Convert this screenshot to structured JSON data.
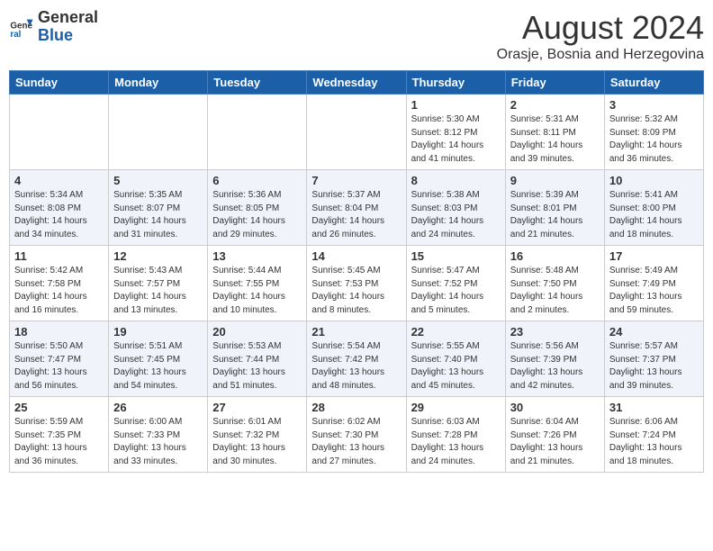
{
  "header": {
    "logo_general": "General",
    "logo_blue": "Blue",
    "month_title": "August 2024",
    "location": "Orasje, Bosnia and Herzegovina"
  },
  "weekdays": [
    "Sunday",
    "Monday",
    "Tuesday",
    "Wednesday",
    "Thursday",
    "Friday",
    "Saturday"
  ],
  "weeks": [
    [
      {
        "day": "",
        "info": ""
      },
      {
        "day": "",
        "info": ""
      },
      {
        "day": "",
        "info": ""
      },
      {
        "day": "",
        "info": ""
      },
      {
        "day": "1",
        "info": "Sunrise: 5:30 AM\nSunset: 8:12 PM\nDaylight: 14 hours\nand 41 minutes."
      },
      {
        "day": "2",
        "info": "Sunrise: 5:31 AM\nSunset: 8:11 PM\nDaylight: 14 hours\nand 39 minutes."
      },
      {
        "day": "3",
        "info": "Sunrise: 5:32 AM\nSunset: 8:09 PM\nDaylight: 14 hours\nand 36 minutes."
      }
    ],
    [
      {
        "day": "4",
        "info": "Sunrise: 5:34 AM\nSunset: 8:08 PM\nDaylight: 14 hours\nand 34 minutes."
      },
      {
        "day": "5",
        "info": "Sunrise: 5:35 AM\nSunset: 8:07 PM\nDaylight: 14 hours\nand 31 minutes."
      },
      {
        "day": "6",
        "info": "Sunrise: 5:36 AM\nSunset: 8:05 PM\nDaylight: 14 hours\nand 29 minutes."
      },
      {
        "day": "7",
        "info": "Sunrise: 5:37 AM\nSunset: 8:04 PM\nDaylight: 14 hours\nand 26 minutes."
      },
      {
        "day": "8",
        "info": "Sunrise: 5:38 AM\nSunset: 8:03 PM\nDaylight: 14 hours\nand 24 minutes."
      },
      {
        "day": "9",
        "info": "Sunrise: 5:39 AM\nSunset: 8:01 PM\nDaylight: 14 hours\nand 21 minutes."
      },
      {
        "day": "10",
        "info": "Sunrise: 5:41 AM\nSunset: 8:00 PM\nDaylight: 14 hours\nand 18 minutes."
      }
    ],
    [
      {
        "day": "11",
        "info": "Sunrise: 5:42 AM\nSunset: 7:58 PM\nDaylight: 14 hours\nand 16 minutes."
      },
      {
        "day": "12",
        "info": "Sunrise: 5:43 AM\nSunset: 7:57 PM\nDaylight: 14 hours\nand 13 minutes."
      },
      {
        "day": "13",
        "info": "Sunrise: 5:44 AM\nSunset: 7:55 PM\nDaylight: 14 hours\nand 10 minutes."
      },
      {
        "day": "14",
        "info": "Sunrise: 5:45 AM\nSunset: 7:53 PM\nDaylight: 14 hours\nand 8 minutes."
      },
      {
        "day": "15",
        "info": "Sunrise: 5:47 AM\nSunset: 7:52 PM\nDaylight: 14 hours\nand 5 minutes."
      },
      {
        "day": "16",
        "info": "Sunrise: 5:48 AM\nSunset: 7:50 PM\nDaylight: 14 hours\nand 2 minutes."
      },
      {
        "day": "17",
        "info": "Sunrise: 5:49 AM\nSunset: 7:49 PM\nDaylight: 13 hours\nand 59 minutes."
      }
    ],
    [
      {
        "day": "18",
        "info": "Sunrise: 5:50 AM\nSunset: 7:47 PM\nDaylight: 13 hours\nand 56 minutes."
      },
      {
        "day": "19",
        "info": "Sunrise: 5:51 AM\nSunset: 7:45 PM\nDaylight: 13 hours\nand 54 minutes."
      },
      {
        "day": "20",
        "info": "Sunrise: 5:53 AM\nSunset: 7:44 PM\nDaylight: 13 hours\nand 51 minutes."
      },
      {
        "day": "21",
        "info": "Sunrise: 5:54 AM\nSunset: 7:42 PM\nDaylight: 13 hours\nand 48 minutes."
      },
      {
        "day": "22",
        "info": "Sunrise: 5:55 AM\nSunset: 7:40 PM\nDaylight: 13 hours\nand 45 minutes."
      },
      {
        "day": "23",
        "info": "Sunrise: 5:56 AM\nSunset: 7:39 PM\nDaylight: 13 hours\nand 42 minutes."
      },
      {
        "day": "24",
        "info": "Sunrise: 5:57 AM\nSunset: 7:37 PM\nDaylight: 13 hours\nand 39 minutes."
      }
    ],
    [
      {
        "day": "25",
        "info": "Sunrise: 5:59 AM\nSunset: 7:35 PM\nDaylight: 13 hours\nand 36 minutes."
      },
      {
        "day": "26",
        "info": "Sunrise: 6:00 AM\nSunset: 7:33 PM\nDaylight: 13 hours\nand 33 minutes."
      },
      {
        "day": "27",
        "info": "Sunrise: 6:01 AM\nSunset: 7:32 PM\nDaylight: 13 hours\nand 30 minutes."
      },
      {
        "day": "28",
        "info": "Sunrise: 6:02 AM\nSunset: 7:30 PM\nDaylight: 13 hours\nand 27 minutes."
      },
      {
        "day": "29",
        "info": "Sunrise: 6:03 AM\nSunset: 7:28 PM\nDaylight: 13 hours\nand 24 minutes."
      },
      {
        "day": "30",
        "info": "Sunrise: 6:04 AM\nSunset: 7:26 PM\nDaylight: 13 hours\nand 21 minutes."
      },
      {
        "day": "31",
        "info": "Sunrise: 6:06 AM\nSunset: 7:24 PM\nDaylight: 13 hours\nand 18 minutes."
      }
    ]
  ]
}
